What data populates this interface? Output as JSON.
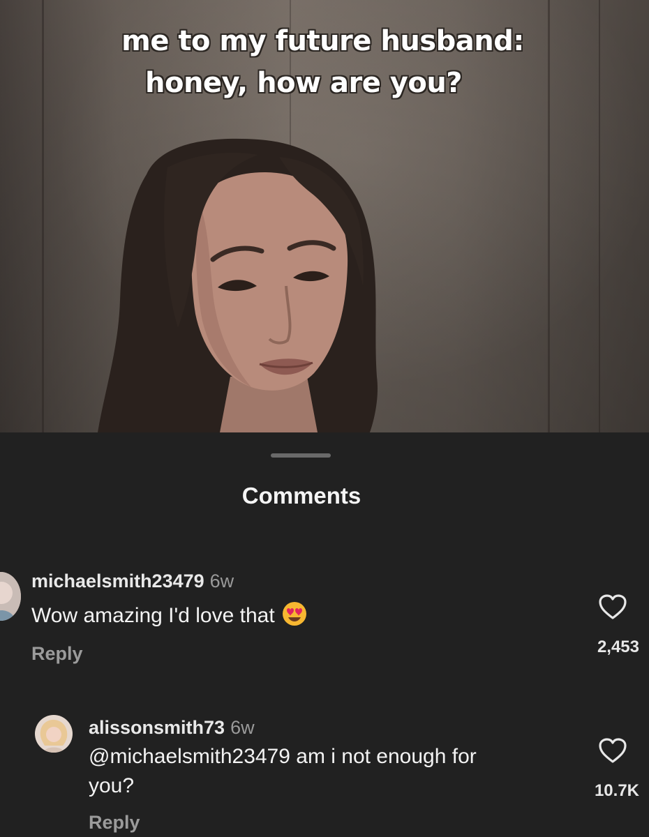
{
  "video": {
    "caption_line1": "me to my future husband:",
    "caption_line2": "honey, how are you?"
  },
  "sheet": {
    "title": "Comments"
  },
  "comments": [
    {
      "username": "michaelsmith23479",
      "time": "6w",
      "text": "Wow amazing I'd love that",
      "emoji": "heart-eyes-emoji",
      "reply_label": "Reply",
      "likes": "2,453",
      "icon": "heart-outline-icon"
    },
    {
      "username": "alissonsmith73",
      "time": "6w",
      "text_line1": "@michaelsmith23479 am i not enough for",
      "text_line2": "you?",
      "reply_label": "Reply",
      "likes": "10.7K",
      "icon": "heart-outline-icon"
    }
  ],
  "colors": {
    "sheet_bg": "#212121",
    "muted_text": "#9b9b9b",
    "heart_eyes_face": "#f7b731",
    "heart_eyes_hearts": "#e0245e"
  }
}
